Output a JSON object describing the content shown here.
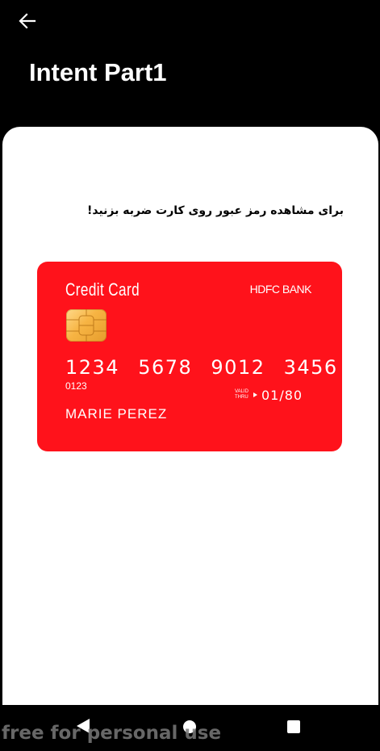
{
  "appbar": {
    "title": "Intent Part1",
    "back_icon": "arrow-back-icon"
  },
  "content": {
    "instruction": "برای مشاهده رمز عبور روی کارت ضربه بزنید!"
  },
  "card": {
    "title": "Credit Card",
    "bank": "HDFC BANK",
    "number": "1234 5678 9012 3456",
    "small_number": "0123",
    "valid_line1": "VALID",
    "valid_line2": "THRU",
    "expiry": "01/80",
    "holder": "MARIE PEREZ",
    "color": "#ff121b",
    "chip_icon": "chip-icon"
  },
  "navbar": {
    "back_icon": "nav-back-icon",
    "home_icon": "nav-home-icon",
    "recents_icon": "nav-recents-icon"
  },
  "watermark": "free for personal use"
}
